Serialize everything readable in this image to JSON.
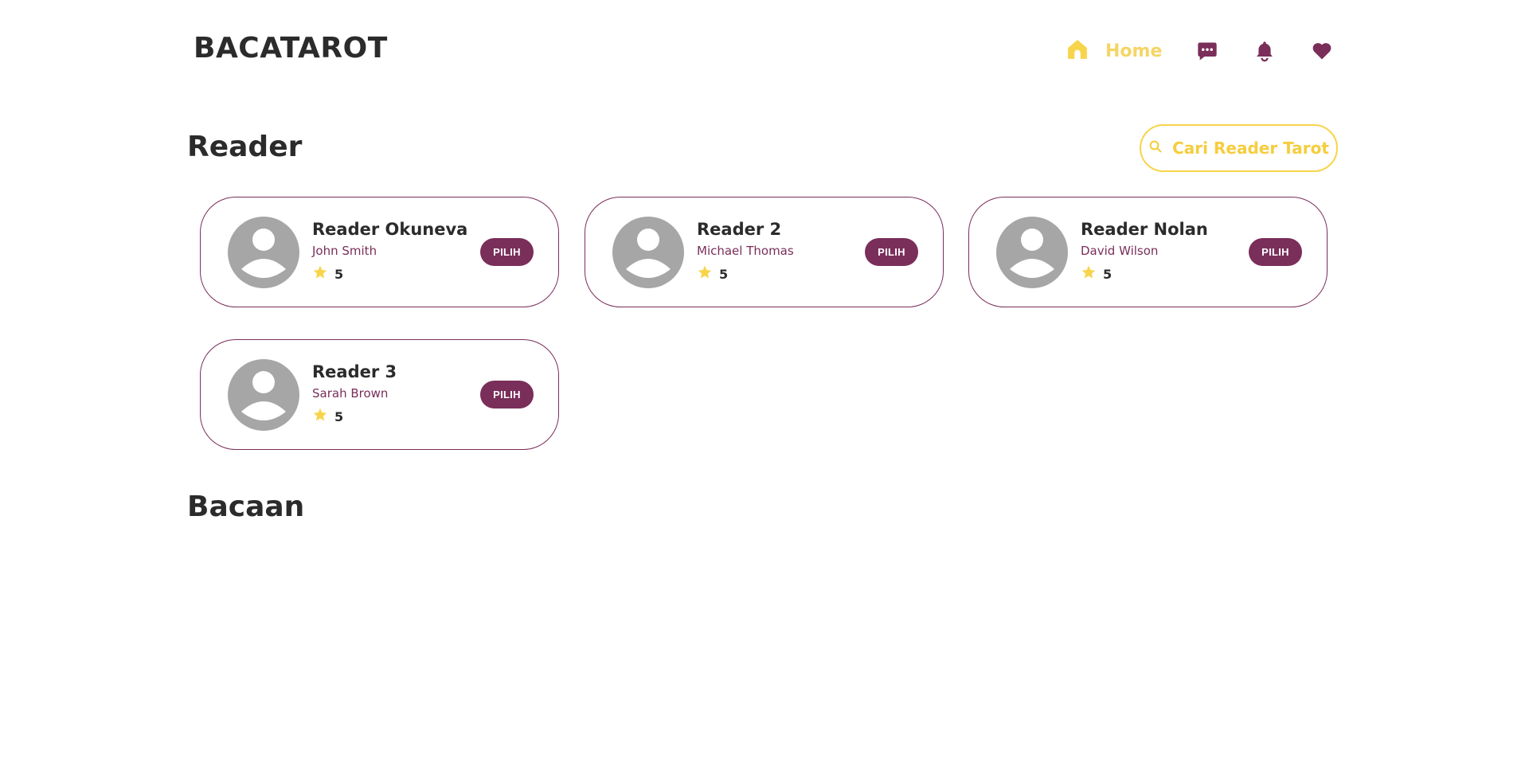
{
  "header": {
    "logo": "BACATAROT",
    "nav": {
      "home_label": "Home",
      "icons": [
        "home-icon",
        "chat-icon",
        "bell-icon",
        "heart-icon"
      ]
    }
  },
  "sections": {
    "reader_title": "Reader",
    "bacaan_title": "Bacaan"
  },
  "search": {
    "label": "Cari Reader Tarot"
  },
  "readers": [
    {
      "name": "Reader Okuneva",
      "person": "John Smith",
      "rating": "5",
      "button": "PILIH"
    },
    {
      "name": "Reader 2",
      "person": "Michael Thomas",
      "rating": "5",
      "button": "PILIH"
    },
    {
      "name": "Reader Nolan",
      "person": "David Wilson",
      "rating": "5",
      "button": "PILIH"
    },
    {
      "name": "Reader 3",
      "person": "Sarah Brown",
      "rating": "5",
      "button": "PILIH"
    }
  ],
  "colors": {
    "accent_yellow": "#f7d44a",
    "accent_purple": "#7a2e5a",
    "avatar_gray": "#a6a6a6",
    "text_dark": "#2b2b2b"
  }
}
